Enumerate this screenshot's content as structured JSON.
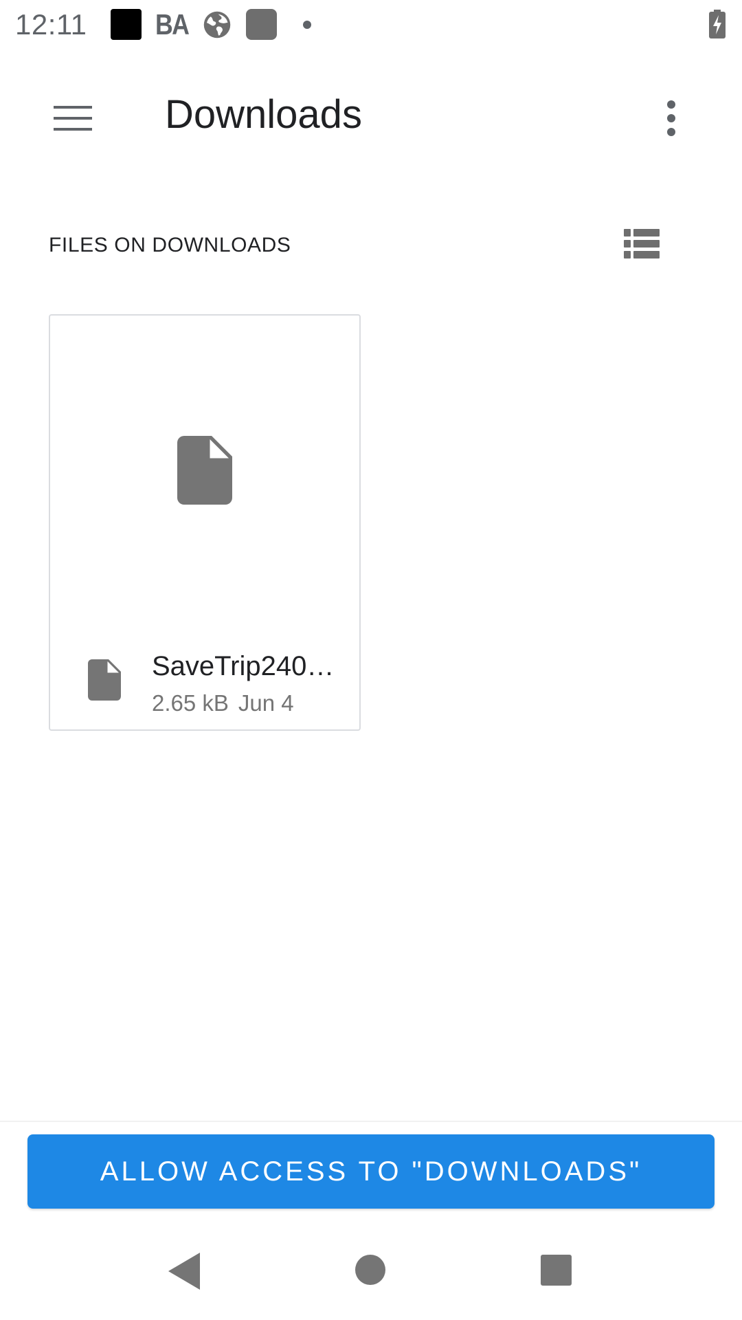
{
  "status_bar": {
    "time": "12:11",
    "ba_label": "BA"
  },
  "app_bar": {
    "title": "Downloads",
    "menu_icon": "hamburger-menu-icon",
    "overflow_icon": "more-vert-icon"
  },
  "section": {
    "title": "FILES ON DOWNLOADS",
    "view_toggle_icon": "list-view-icon"
  },
  "files": [
    {
      "name": "SaveTrip240…",
      "size": "2.65 kB",
      "date": "Jun 4",
      "icon": "file-icon"
    }
  ],
  "allow_button": {
    "label": "ALLOW ACCESS TO \"DOWNLOADS\""
  },
  "colors": {
    "accent": "#1e88e5",
    "icon_gray": "#757575",
    "text_primary": "#202124"
  }
}
